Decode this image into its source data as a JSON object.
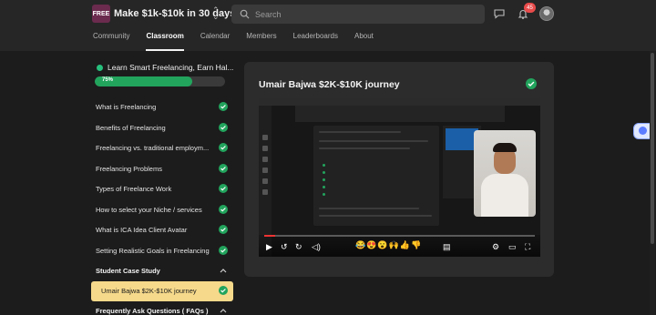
{
  "header": {
    "logo_text": "FREE",
    "group_title": "Make $1k-$10k in 30 days",
    "search_placeholder": "Search",
    "notification_count": "45",
    "tabs": [
      {
        "label": "Community",
        "active": false
      },
      {
        "label": "Classroom",
        "active": true
      },
      {
        "label": "Calendar",
        "active": false
      },
      {
        "label": "Members",
        "active": false
      },
      {
        "label": "Leaderboards",
        "active": false
      },
      {
        "label": "About",
        "active": false
      }
    ]
  },
  "sidebar": {
    "course_title": "Learn Smart Freelancing, Earn Hal...",
    "progress_percent": 75,
    "progress_label": "75%",
    "lessons": [
      {
        "label": "What is Freelancing",
        "completed": true
      },
      {
        "label": "Benefits of Freelancing",
        "completed": true
      },
      {
        "label": "Freelancing vs. traditional employm...",
        "completed": true
      },
      {
        "label": "Freelancing Problems",
        "completed": true
      },
      {
        "label": "Types of Freelance Work",
        "completed": true
      },
      {
        "label": "How to select your Niche / services",
        "completed": true
      },
      {
        "label": "What is ICA Idea Client Avatar",
        "completed": true
      },
      {
        "label": "Setting Realistic Goals in Freelancing",
        "completed": true
      }
    ],
    "section_case_study": "Student Case Study",
    "active_lesson": {
      "label": "Umair Bajwa $2K-$10K journey",
      "completed": true
    },
    "section_faq": "Frequently Ask Questions ( FAQs )"
  },
  "main": {
    "lesson_title": "Umair Bajwa $2K-$10K journey",
    "video_reactions": "😂😍😮🙌👍👎",
    "video_progress": 0.04
  },
  "colors": {
    "accent_green": "#22a45d",
    "active_highlight": "#f6d98b",
    "badge_red": "#e84b4b"
  }
}
